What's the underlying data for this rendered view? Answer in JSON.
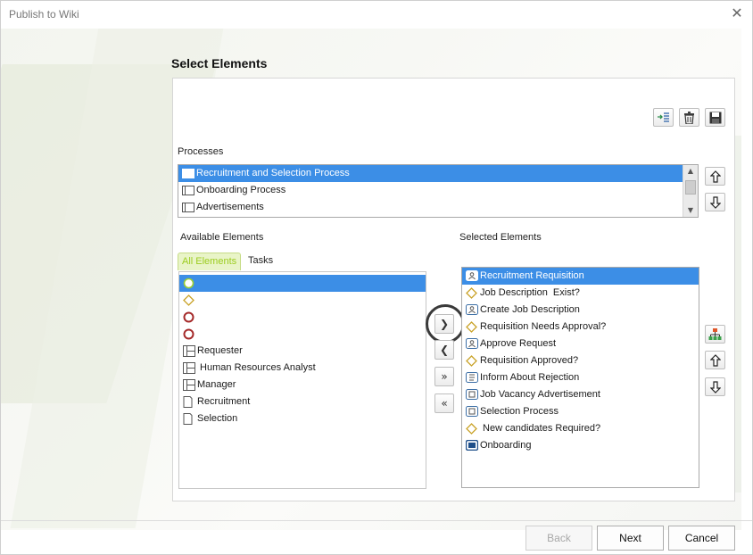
{
  "window": {
    "title": "Publish to Wiki",
    "close_glyph": "✕"
  },
  "section_title": "Select Elements",
  "processes": {
    "label": "Processes",
    "items": [
      {
        "label": "Recruitment and Selection Process",
        "icon": "pool-icon",
        "selected": true
      },
      {
        "label": "Onboarding Process",
        "icon": "pool-icon",
        "selected": false
      },
      {
        "label": "Advertisements",
        "icon": "pool-icon",
        "selected": false
      }
    ]
  },
  "available": {
    "label": "Available Elements",
    "tabs": [
      {
        "label": "All Elements",
        "active": true
      },
      {
        "label": "Tasks",
        "active": false
      }
    ],
    "items": [
      {
        "label": "",
        "icon": "start-event-icon",
        "selected": true
      },
      {
        "label": "",
        "icon": "gateway-icon",
        "selected": false
      },
      {
        "label": "",
        "icon": "end-event-icon",
        "selected": false
      },
      {
        "label": "",
        "icon": "end-event-icon",
        "selected": false
      },
      {
        "label": "Requester",
        "icon": "lane-icon",
        "selected": false
      },
      {
        "label": " Human Resources Analyst",
        "icon": "lane-icon",
        "selected": false
      },
      {
        "label": "Manager",
        "icon": "lane-icon",
        "selected": false
      },
      {
        "label": "Recruitment",
        "icon": "document-icon",
        "selected": false
      },
      {
        "label": "Selection",
        "icon": "document-icon",
        "selected": false
      }
    ]
  },
  "selected": {
    "label": "Selected Elements",
    "items": [
      {
        "label": "Recruitment Requisition",
        "icon": "user-task-icon",
        "selected": true
      },
      {
        "label": "Job Description  Exist?",
        "icon": "gateway-icon",
        "selected": false
      },
      {
        "label": "Create Job Description",
        "icon": "user-task-icon",
        "selected": false
      },
      {
        "label": "Requisition Needs Approval?",
        "icon": "gateway-icon",
        "selected": false
      },
      {
        "label": "Approve Request",
        "icon": "user-task-icon",
        "selected": false
      },
      {
        "label": "Requisition Approved?",
        "icon": "gateway-icon",
        "selected": false
      },
      {
        "label": "Inform About Rejection",
        "icon": "script-task-icon",
        "selected": false
      },
      {
        "label": "Job Vacancy Advertisement",
        "icon": "task-icon",
        "selected": false
      },
      {
        "label": "Selection Process",
        "icon": "task-icon",
        "selected": false
      },
      {
        "label": " New candidates Required?",
        "icon": "gateway-icon",
        "selected": false
      },
      {
        "label": "Onboarding",
        "icon": "subprocess-icon",
        "selected": false
      }
    ]
  },
  "transfer_buttons": {
    "add": "❯",
    "remove": "❮",
    "add_all": "»",
    "remove_all": "«"
  },
  "footer": {
    "back": "Back",
    "next": "Next",
    "cancel": "Cancel"
  },
  "colors": {
    "selection": "#3c8ee6",
    "tab_accent": "#9ccc1f",
    "gateway": "#c9a227",
    "end_event": "#a52a2a",
    "task_border": "#3d6fa6"
  }
}
